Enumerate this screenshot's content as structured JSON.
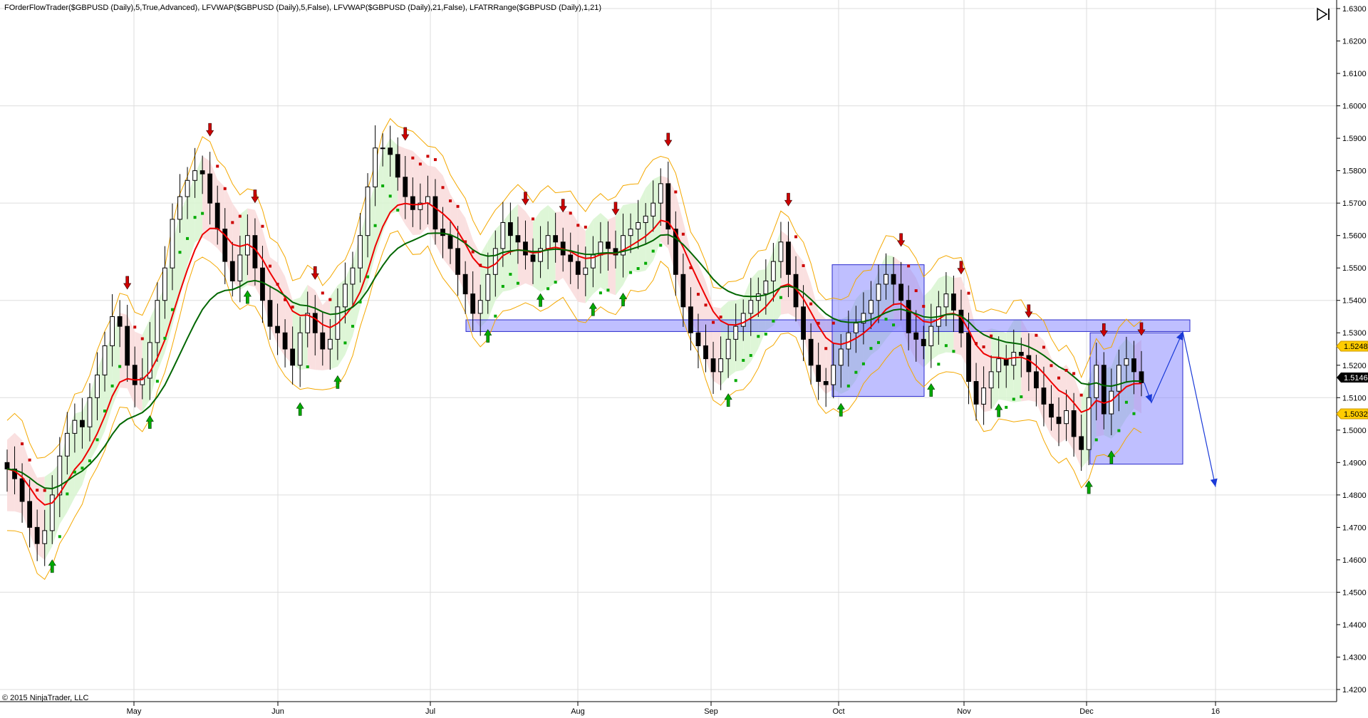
{
  "header": {
    "indicators": "FOrderFlowTrader($GBPUSD (Daily),5,True,Advanced), LFVWAP($GBPUSD (Daily),5,False), LFVWAP($GBPUSD (Daily),21,False), LFATRRange($GBPUSD (Daily),1,21)"
  },
  "footer": {
    "copyright": "© 2015 NinjaTrader, LLC"
  },
  "price_labels": {
    "high": "1.5248",
    "last": "1.5146",
    "low": "1.5032"
  },
  "colors": {
    "bull": "#00aa00",
    "bear": "#cc0000",
    "vwap_fast": "#ee0000",
    "vwap_slow": "#006600",
    "atr_band": "#f4a800",
    "zone_fill": "#8080ff",
    "zone_stroke": "#2a2acc",
    "projection": "#1a3ad8",
    "bull_shade": "#d8f5d0",
    "bear_shade": "#f9dada",
    "last_label": "#000000",
    "level_label": "#ffcc00"
  },
  "chart_data": {
    "type": "candlestick",
    "symbol": "$GBPUSD",
    "timeframe": "Daily",
    "ylim": [
      1.415,
      1.632
    ],
    "yticks": [
      "1.6300",
      "1.6200",
      "1.6100",
      "1.6000",
      "1.5900",
      "1.5800",
      "1.5700",
      "1.5600",
      "1.5500",
      "1.5400",
      "1.5300",
      "1.5200",
      "1.5100",
      "1.5000",
      "1.4900",
      "1.4800",
      "1.4700",
      "1.4600",
      "1.4500",
      "1.4400",
      "1.4300",
      "1.4200"
    ],
    "xticks": [
      "May",
      "Jun",
      "Jul",
      "Aug",
      "Sep",
      "Oct",
      "Nov",
      "Dec",
      "16"
    ],
    "legend": "none",
    "grid": true,
    "closes": [
      1.488,
      1.485,
      1.478,
      1.47,
      1.465,
      1.469,
      1.48,
      1.492,
      1.499,
      1.503,
      1.501,
      1.51,
      1.517,
      1.526,
      1.535,
      1.532,
      1.52,
      1.514,
      1.516,
      1.527,
      1.54,
      1.55,
      1.565,
      1.572,
      1.577,
      1.58,
      1.579,
      1.57,
      1.562,
      1.552,
      1.546,
      1.554,
      1.56,
      1.55,
      1.54,
      1.532,
      1.53,
      1.525,
      1.52,
      1.53,
      1.536,
      1.53,
      1.525,
      1.528,
      1.538,
      1.545,
      1.55,
      1.56,
      1.575,
      1.587,
      1.587,
      1.585,
      1.578,
      1.572,
      1.568,
      1.57,
      1.572,
      1.562,
      1.56,
      1.556,
      1.548,
      1.542,
      1.536,
      1.54,
      1.548,
      1.556,
      1.564,
      1.56,
      1.558,
      1.554,
      1.552,
      1.556,
      1.56,
      1.558,
      1.554,
      1.552,
      1.548,
      1.55,
      1.554,
      1.558,
      1.556,
      1.554,
      1.56,
      1.562,
      1.564,
      1.566,
      1.57,
      1.576,
      1.562,
      1.548,
      1.538,
      1.53,
      1.526,
      1.522,
      1.518,
      1.522,
      1.528,
      1.532,
      1.536,
      1.54,
      1.542,
      1.546,
      1.552,
      1.558,
      1.548,
      1.538,
      1.528,
      1.52,
      1.515,
      1.514,
      1.52,
      1.525,
      1.53,
      1.533,
      1.536,
      1.54,
      1.545,
      1.548,
      1.545,
      1.54,
      1.53,
      1.528,
      1.526,
      1.532,
      1.538,
      1.542,
      1.537,
      1.53,
      1.515,
      1.508,
      1.513,
      1.518,
      1.522,
      1.52,
      1.524,
      1.523,
      1.518,
      1.513,
      1.508,
      1.504,
      1.502,
      1.506,
      1.498,
      1.494,
      1.51,
      1.52,
      1.505,
      1.512,
      1.52,
      1.522,
      1.518,
      1.5146
    ],
    "annotations": {
      "resistance_zone": [
        1.5304,
        1.534
      ],
      "box_oct": [
        1.5104,
        1.551
      ],
      "box_dec": [
        1.4895,
        1.53
      ],
      "projection": [
        1.5146,
        1.5085,
        1.5303,
        1.4825
      ]
    }
  }
}
